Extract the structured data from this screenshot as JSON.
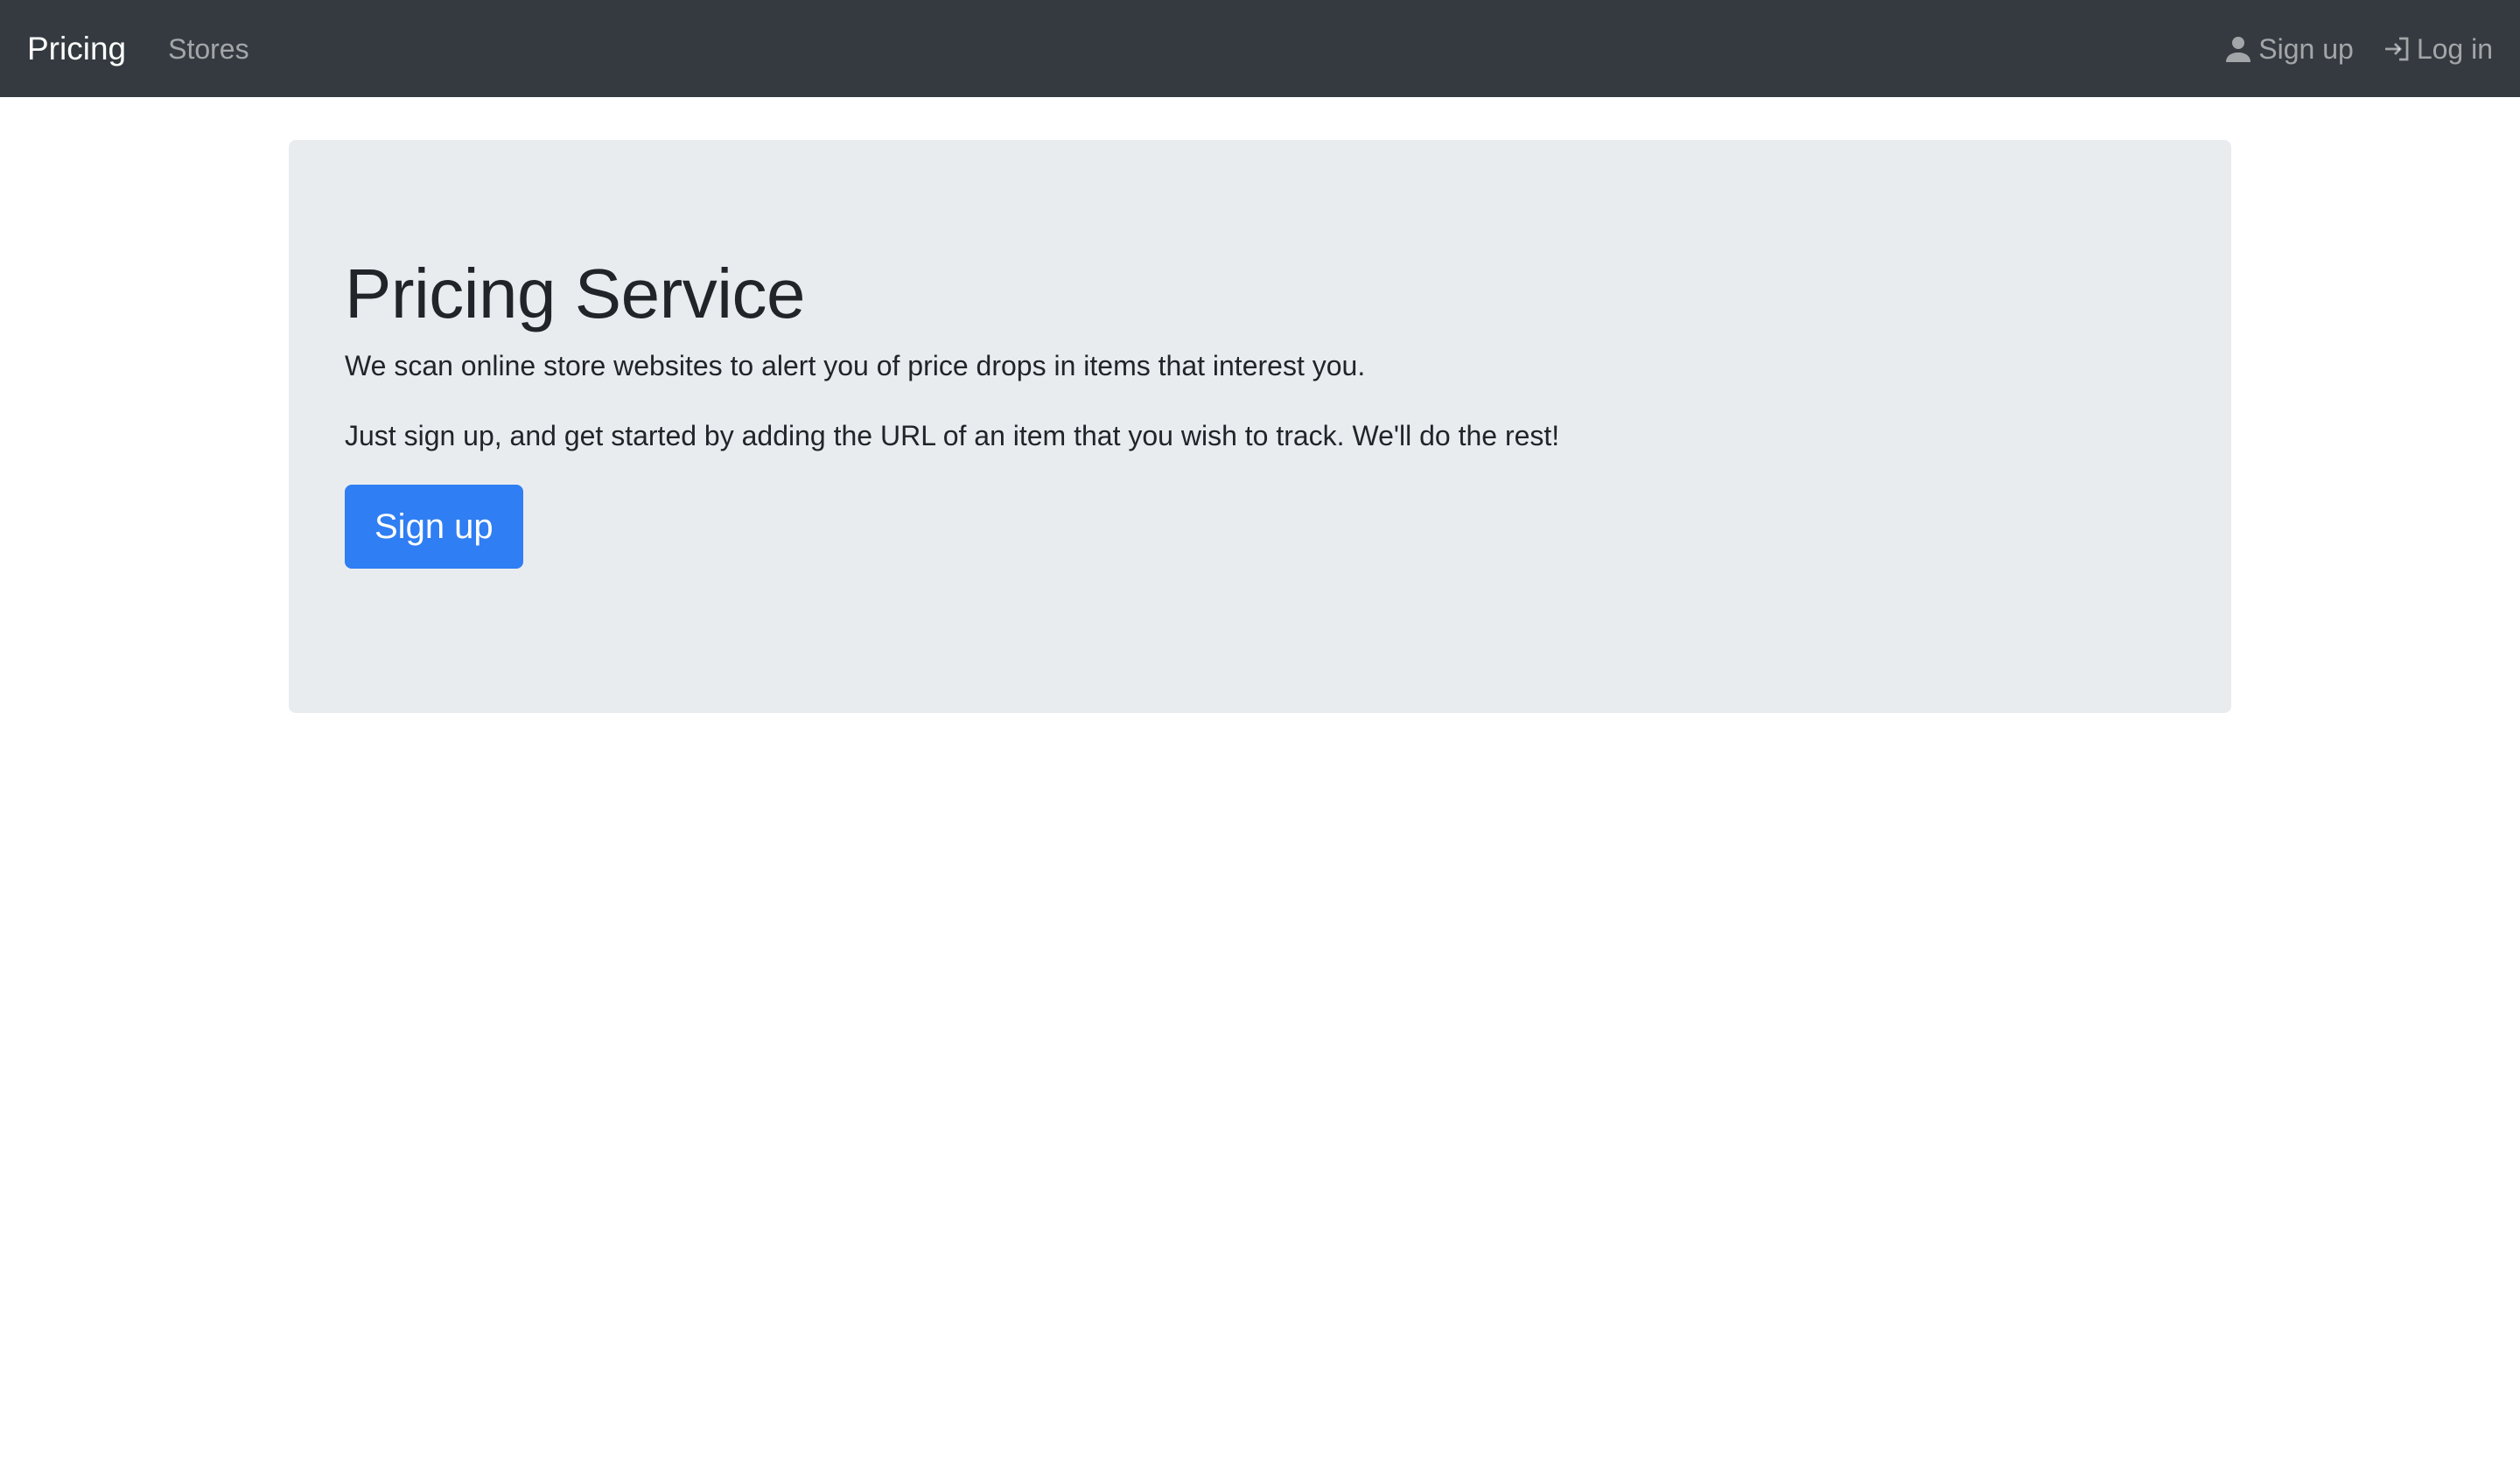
{
  "navbar": {
    "brand": "Pricing",
    "links": [
      {
        "label": "Stores"
      }
    ],
    "right_links": [
      {
        "label": "Sign up",
        "icon": "person-icon"
      },
      {
        "label": "Log in",
        "icon": "login-icon"
      }
    ]
  },
  "hero": {
    "title": "Pricing Service",
    "paragraphs": [
      "We scan online store websites to alert you of price drops in items that interest you.",
      "Just sign up, and get started by adding the URL of an item that you wish to track. We'll do the rest!"
    ],
    "button_label": "Sign up"
  },
  "colors": {
    "navbar_bg": "#343a40",
    "jumbotron_bg": "#e9ecef",
    "primary": "#2f7ef3"
  }
}
